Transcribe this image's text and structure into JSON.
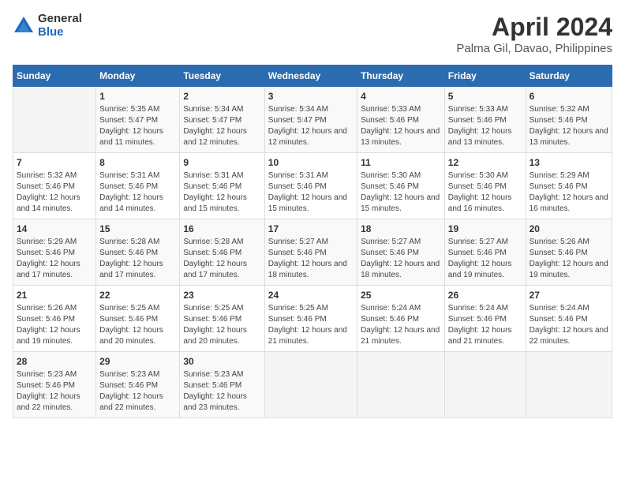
{
  "logo": {
    "general": "General",
    "blue": "Blue"
  },
  "title": "April 2024",
  "subtitle": "Palma Gil, Davao, Philippines",
  "days_of_week": [
    "Sunday",
    "Monday",
    "Tuesday",
    "Wednesday",
    "Thursday",
    "Friday",
    "Saturday"
  ],
  "weeks": [
    [
      {
        "day": "",
        "sunrise": "",
        "sunset": "",
        "daylight": ""
      },
      {
        "day": "1",
        "sunrise": "Sunrise: 5:35 AM",
        "sunset": "Sunset: 5:47 PM",
        "daylight": "Daylight: 12 hours and 11 minutes."
      },
      {
        "day": "2",
        "sunrise": "Sunrise: 5:34 AM",
        "sunset": "Sunset: 5:47 PM",
        "daylight": "Daylight: 12 hours and 12 minutes."
      },
      {
        "day": "3",
        "sunrise": "Sunrise: 5:34 AM",
        "sunset": "Sunset: 5:47 PM",
        "daylight": "Daylight: 12 hours and 12 minutes."
      },
      {
        "day": "4",
        "sunrise": "Sunrise: 5:33 AM",
        "sunset": "Sunset: 5:46 PM",
        "daylight": "Daylight: 12 hours and 13 minutes."
      },
      {
        "day": "5",
        "sunrise": "Sunrise: 5:33 AM",
        "sunset": "Sunset: 5:46 PM",
        "daylight": "Daylight: 12 hours and 13 minutes."
      },
      {
        "day": "6",
        "sunrise": "Sunrise: 5:32 AM",
        "sunset": "Sunset: 5:46 PM",
        "daylight": "Daylight: 12 hours and 13 minutes."
      }
    ],
    [
      {
        "day": "7",
        "sunrise": "Sunrise: 5:32 AM",
        "sunset": "Sunset: 5:46 PM",
        "daylight": "Daylight: 12 hours and 14 minutes."
      },
      {
        "day": "8",
        "sunrise": "Sunrise: 5:31 AM",
        "sunset": "Sunset: 5:46 PM",
        "daylight": "Daylight: 12 hours and 14 minutes."
      },
      {
        "day": "9",
        "sunrise": "Sunrise: 5:31 AM",
        "sunset": "Sunset: 5:46 PM",
        "daylight": "Daylight: 12 hours and 15 minutes."
      },
      {
        "day": "10",
        "sunrise": "Sunrise: 5:31 AM",
        "sunset": "Sunset: 5:46 PM",
        "daylight": "Daylight: 12 hours and 15 minutes."
      },
      {
        "day": "11",
        "sunrise": "Sunrise: 5:30 AM",
        "sunset": "Sunset: 5:46 PM",
        "daylight": "Daylight: 12 hours and 15 minutes."
      },
      {
        "day": "12",
        "sunrise": "Sunrise: 5:30 AM",
        "sunset": "Sunset: 5:46 PM",
        "daylight": "Daylight: 12 hours and 16 minutes."
      },
      {
        "day": "13",
        "sunrise": "Sunrise: 5:29 AM",
        "sunset": "Sunset: 5:46 PM",
        "daylight": "Daylight: 12 hours and 16 minutes."
      }
    ],
    [
      {
        "day": "14",
        "sunrise": "Sunrise: 5:29 AM",
        "sunset": "Sunset: 5:46 PM",
        "daylight": "Daylight: 12 hours and 17 minutes."
      },
      {
        "day": "15",
        "sunrise": "Sunrise: 5:28 AM",
        "sunset": "Sunset: 5:46 PM",
        "daylight": "Daylight: 12 hours and 17 minutes."
      },
      {
        "day": "16",
        "sunrise": "Sunrise: 5:28 AM",
        "sunset": "Sunset: 5:46 PM",
        "daylight": "Daylight: 12 hours and 17 minutes."
      },
      {
        "day": "17",
        "sunrise": "Sunrise: 5:27 AM",
        "sunset": "Sunset: 5:46 PM",
        "daylight": "Daylight: 12 hours and 18 minutes."
      },
      {
        "day": "18",
        "sunrise": "Sunrise: 5:27 AM",
        "sunset": "Sunset: 5:46 PM",
        "daylight": "Daylight: 12 hours and 18 minutes."
      },
      {
        "day": "19",
        "sunrise": "Sunrise: 5:27 AM",
        "sunset": "Sunset: 5:46 PM",
        "daylight": "Daylight: 12 hours and 19 minutes."
      },
      {
        "day": "20",
        "sunrise": "Sunrise: 5:26 AM",
        "sunset": "Sunset: 5:46 PM",
        "daylight": "Daylight: 12 hours and 19 minutes."
      }
    ],
    [
      {
        "day": "21",
        "sunrise": "Sunrise: 5:26 AM",
        "sunset": "Sunset: 5:46 PM",
        "daylight": "Daylight: 12 hours and 19 minutes."
      },
      {
        "day": "22",
        "sunrise": "Sunrise: 5:25 AM",
        "sunset": "Sunset: 5:46 PM",
        "daylight": "Daylight: 12 hours and 20 minutes."
      },
      {
        "day": "23",
        "sunrise": "Sunrise: 5:25 AM",
        "sunset": "Sunset: 5:46 PM",
        "daylight": "Daylight: 12 hours and 20 minutes."
      },
      {
        "day": "24",
        "sunrise": "Sunrise: 5:25 AM",
        "sunset": "Sunset: 5:46 PM",
        "daylight": "Daylight: 12 hours and 21 minutes."
      },
      {
        "day": "25",
        "sunrise": "Sunrise: 5:24 AM",
        "sunset": "Sunset: 5:46 PM",
        "daylight": "Daylight: 12 hours and 21 minutes."
      },
      {
        "day": "26",
        "sunrise": "Sunrise: 5:24 AM",
        "sunset": "Sunset: 5:46 PM",
        "daylight": "Daylight: 12 hours and 21 minutes."
      },
      {
        "day": "27",
        "sunrise": "Sunrise: 5:24 AM",
        "sunset": "Sunset: 5:46 PM",
        "daylight": "Daylight: 12 hours and 22 minutes."
      }
    ],
    [
      {
        "day": "28",
        "sunrise": "Sunrise: 5:23 AM",
        "sunset": "Sunset: 5:46 PM",
        "daylight": "Daylight: 12 hours and 22 minutes."
      },
      {
        "day": "29",
        "sunrise": "Sunrise: 5:23 AM",
        "sunset": "Sunset: 5:46 PM",
        "daylight": "Daylight: 12 hours and 22 minutes."
      },
      {
        "day": "30",
        "sunrise": "Sunrise: 5:23 AM",
        "sunset": "Sunset: 5:46 PM",
        "daylight": "Daylight: 12 hours and 23 minutes."
      },
      {
        "day": "",
        "sunrise": "",
        "sunset": "",
        "daylight": ""
      },
      {
        "day": "",
        "sunrise": "",
        "sunset": "",
        "daylight": ""
      },
      {
        "day": "",
        "sunrise": "",
        "sunset": "",
        "daylight": ""
      },
      {
        "day": "",
        "sunrise": "",
        "sunset": "",
        "daylight": ""
      }
    ]
  ]
}
